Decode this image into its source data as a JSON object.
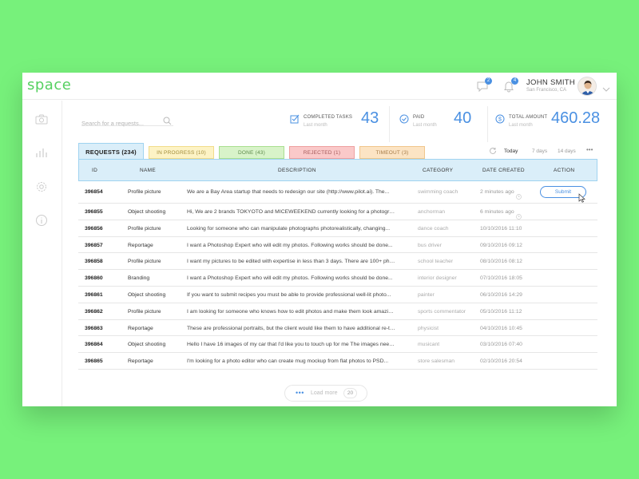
{
  "app": {
    "logo": "space"
  },
  "header": {
    "notifications": [
      {
        "icon": "chat-bubble-icon",
        "count": "2"
      },
      {
        "icon": "bell-icon",
        "count": "4"
      }
    ],
    "user": {
      "name": "JOHN SMITH",
      "location": "San Francisco, CA"
    }
  },
  "sidebar": {
    "items": [
      {
        "icon": "camera-icon"
      },
      {
        "icon": "bar-chart-icon"
      },
      {
        "icon": "gear-icon"
      },
      {
        "icon": "info-icon"
      }
    ]
  },
  "search": {
    "placeholder": "Search for a requests..."
  },
  "stats": [
    {
      "icon": "checkbox-icon",
      "label": "COMPLETED TASKS",
      "sub": "Last month",
      "value": "43"
    },
    {
      "icon": "check-circle-icon",
      "label": "PAID",
      "sub": "Last month",
      "value": "40"
    },
    {
      "icon": "dollar-icon",
      "label": "TOTAL AMOUNT",
      "sub": "Last month",
      "value": "460.28"
    }
  ],
  "tabs": [
    {
      "label": "REQUESTS (234)",
      "color": "#daeef9"
    },
    {
      "label": "IN PROGRESS (10)",
      "color": "#fdf3c5"
    },
    {
      "label": "DONE (43)",
      "color": "#d8f3c9"
    },
    {
      "label": "REJECTED (1)",
      "color": "#fac9c9"
    },
    {
      "label": "TIMEOUT (3)",
      "color": "#fce4c4"
    }
  ],
  "range": {
    "options": [
      "Today",
      "7 days",
      "14 days"
    ],
    "selected": "Today",
    "more": "•••"
  },
  "table": {
    "columns": [
      "ID",
      "NAME",
      "DESCRIPTION",
      "CATEGORY",
      "DATE CREATED",
      "ACTION"
    ],
    "rows": [
      {
        "id": "396854",
        "name": "Profile picture",
        "desc": "We are a Bay Area startup that needs to redesign our site (http://www.pilot.ai). The...",
        "cat": "swimming coach",
        "date": "2 minutes ago",
        "action": "Submit"
      },
      {
        "id": "396855",
        "name": "Object shooting",
        "desc": "Hi, We are 2 brands TOKYOTO and MICEWEEKEND currently looking for a photographer...",
        "cat": "anchorman",
        "date": "6 minutes ago"
      },
      {
        "id": "396856",
        "name": "Profile picture",
        "desc": "Looking for someone who can manipulate photographs photorealistically, changing...",
        "cat": "dance coach",
        "date": "10/10/2016 11:10"
      },
      {
        "id": "396857",
        "name": "Reportage",
        "desc": "I want a Photoshop Expert who will edit my photos. Following works should be done...",
        "cat": "bus driver",
        "date": "09/10/2016 09:12"
      },
      {
        "id": "396858",
        "name": "Profile picture",
        "desc": "I want my pictures to be edited with expertise in less than 3 days. There are 100+ pho...",
        "cat": "school teacher",
        "date": "08/10/2016 08:12"
      },
      {
        "id": "396860",
        "name": "Branding",
        "desc": "I want a Photoshop Expert who will edit my photos. Following works should be done...",
        "cat": "interior designer",
        "date": "07/10/2016 18:05"
      },
      {
        "id": "396861",
        "name": "Object shooting",
        "desc": "If you want to submit recipes you must be able to provide professional well-lit photo...",
        "cat": "painter",
        "date": "06/10/2016 14:29"
      },
      {
        "id": "396862",
        "name": "Profile picture",
        "desc": "I am looking for someone who knows how to edit photos and make them look amazing...",
        "cat": "sports commentator",
        "date": "05/10/2016 11:12"
      },
      {
        "id": "396863",
        "name": "Reportage",
        "desc": "These are professional portraits, but the client would like them to have additional re-tou...",
        "cat": "physicist",
        "date": "04/10/2016 10:45"
      },
      {
        "id": "396864",
        "name": "Object shooting",
        "desc": "Hello I have 16 images of my car that I'd like you to touch up for me The images need...",
        "cat": "musicant",
        "date": "03/10/2016 07:40"
      },
      {
        "id": "396865",
        "name": "Reportage",
        "desc": "I'm looking for a photo editor who can create mug mockup from flat photos to PSD...",
        "cat": "store salesman",
        "date": "02/10/2016 20:54"
      }
    ]
  },
  "load_more": {
    "dots": "•••",
    "label": "Load more",
    "count": "20"
  },
  "colors": {
    "accent": "#4a90e2",
    "logo": "#55d060",
    "background": "#77f17b"
  }
}
